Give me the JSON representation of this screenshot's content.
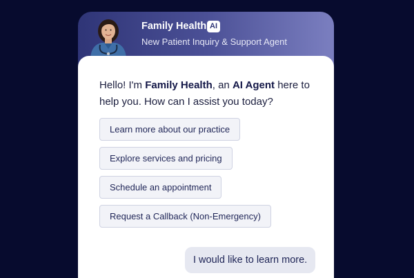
{
  "agent": {
    "name": "Family Health",
    "badge": "AI",
    "role": "New Patient Inquiry & Support Agent",
    "avatar": "nurse-avatar"
  },
  "chat": {
    "greeting": {
      "prefix": "Hello! I'm ",
      "name": "Family Health",
      "middle": ", an ",
      "agent_label": "AI Agent",
      "suffix": " here to help you. How can I assist you today?"
    },
    "options": [
      {
        "label": "Learn more about our practice"
      },
      {
        "label": "Explore services and pricing"
      },
      {
        "label": "Schedule an appointment"
      },
      {
        "label": "Request a Callback (Non-Emergency)"
      }
    ],
    "user_message": "I would like to learn more."
  },
  "colors": {
    "page_background": "#070b2e",
    "header_start": "#2f3577",
    "header_end": "#7b7fc0",
    "option_background": "#f2f3f8",
    "text_primary": "#1e2456"
  }
}
